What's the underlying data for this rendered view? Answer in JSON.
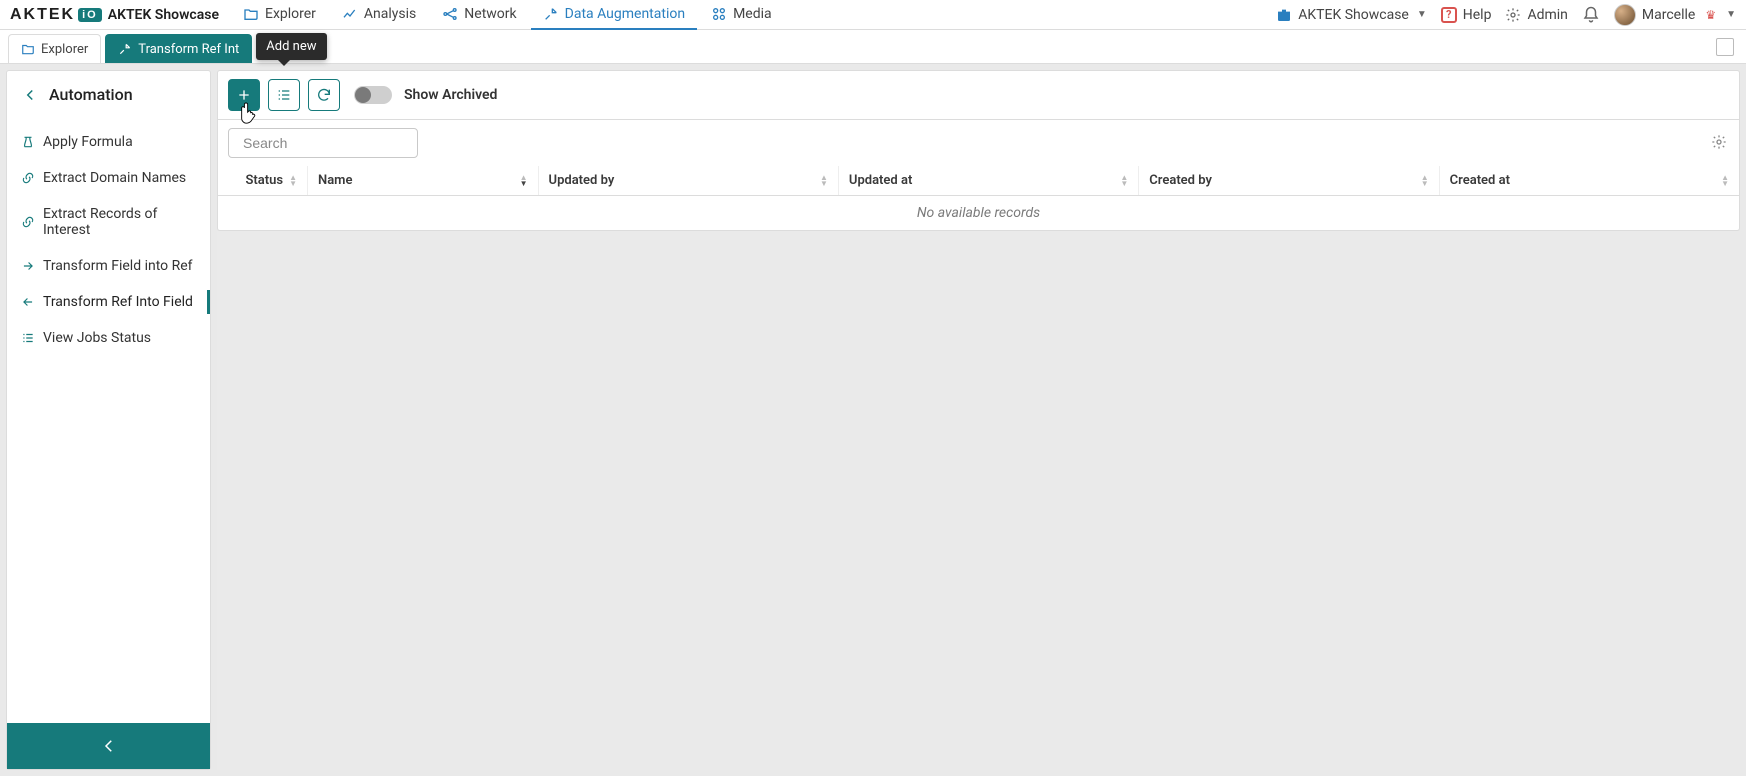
{
  "brand": {
    "name": "AKTEK",
    "io": "iO",
    "workspace": "AKTEK Showcase"
  },
  "nav": {
    "items": [
      {
        "label": "Explorer"
      },
      {
        "label": "Analysis"
      },
      {
        "label": "Network"
      },
      {
        "label": "Data Augmentation"
      },
      {
        "label": "Media"
      }
    ],
    "active_index": 3
  },
  "top_right": {
    "workspace_switcher": "AKTEK Showcase",
    "help": "Help",
    "admin": "Admin",
    "user": "Marcelle"
  },
  "tabs": {
    "items": [
      {
        "label": "Explorer"
      },
      {
        "label": "Transform Ref Int"
      }
    ],
    "active_index": 1,
    "tooltip": "Add new"
  },
  "sidebar": {
    "heading": "Automation",
    "items": [
      {
        "label": "Apply Formula"
      },
      {
        "label": "Extract Domain Names"
      },
      {
        "label": "Extract Records of Interest"
      },
      {
        "label": "Transform Field into Ref"
      },
      {
        "label": "Transform Ref Into Field"
      },
      {
        "label": "View Jobs Status"
      }
    ],
    "selected_index": 4
  },
  "toolbar": {
    "show_archived_label": "Show Archived",
    "search_placeholder": "Search"
  },
  "table": {
    "columns": {
      "status": "Status",
      "name": "Name",
      "updated_by": "Updated by",
      "updated_at": "Updated at",
      "created_by": "Created by",
      "created_at": "Created at"
    },
    "empty_message": "No available records"
  }
}
